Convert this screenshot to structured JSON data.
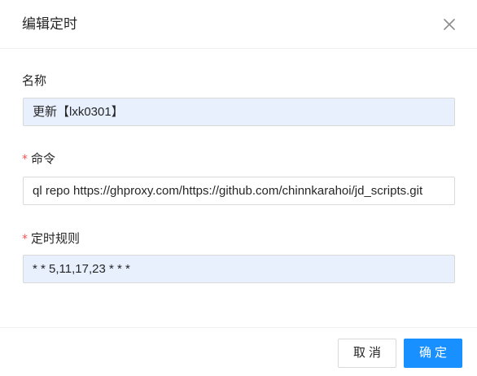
{
  "dialog": {
    "title": "编辑定时",
    "close_icon": "close-icon"
  },
  "form": {
    "name": {
      "label": "名称",
      "required": false,
      "value": "更新【lxk0301】"
    },
    "command": {
      "label": "命令",
      "required": true,
      "value": "ql repo https://ghproxy.com/https://github.com/chinnkarahoi/jd_scripts.git"
    },
    "schedule": {
      "label": "定时规则",
      "required": true,
      "value": "* * 5,11,17,23 * * *"
    },
    "required_mark": "*"
  },
  "footer": {
    "cancel_label": "取消",
    "ok_label": "确定"
  },
  "colors": {
    "primary": "#1890ff",
    "required": "#ff4d4f",
    "autofill_bg": "#e8f0fe"
  }
}
